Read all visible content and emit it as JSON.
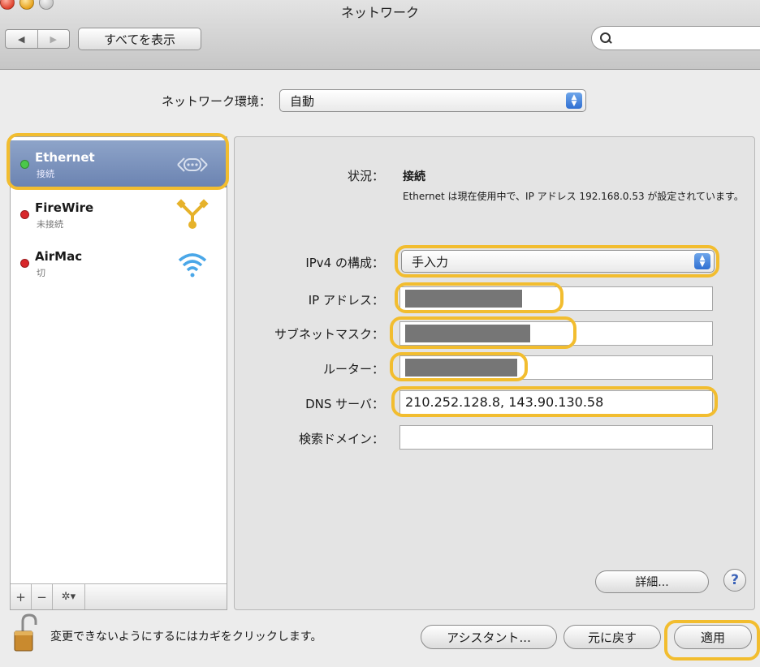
{
  "window": {
    "title": "ネットワーク"
  },
  "toolbar": {
    "back_glyph": "◀",
    "forward_glyph": "▶",
    "show_all_label": "すべてを表示",
    "search_value": "",
    "search_icon": "search-icon"
  },
  "location": {
    "label": "ネットワーク環境：",
    "value": "自動"
  },
  "sidebar": {
    "services": [
      {
        "name": "Ethernet",
        "status": "接続",
        "status_color": "#4bc84b",
        "icon": "ethernet-icon",
        "selected": true
      },
      {
        "name": "FireWire",
        "status": "未接続",
        "status_color": "#d8262a",
        "icon": "firewire-icon",
        "selected": false
      },
      {
        "name": "AirMac",
        "status": "切",
        "status_color": "#d8262a",
        "icon": "wifi-icon",
        "selected": false
      }
    ],
    "add_label": "+",
    "remove_label": "−",
    "gear_label": "✲▾"
  },
  "detail": {
    "status_label": "状況：",
    "status_value": "接続",
    "status_description": "Ethernet は現在使用中で、IP アドレス 192.168.0.53 が設定されています。",
    "ipv4_label": "IPv4 の構成：",
    "ipv4_value": "手入力",
    "ip_label": "IP アドレス：",
    "subnet_label": "サブネットマスク：",
    "router_label": "ルーター：",
    "dns_label": "DNS サーバ：",
    "dns_value": "210.252.128.8, 143.90.130.58",
    "search_domain_label": "検索ドメイン：",
    "search_domain_value": "",
    "advanced_label": "詳細...",
    "help_label": "?"
  },
  "footer": {
    "lock_text": "変更できないようにするにはカギをクリックします。",
    "assistant_label": "アシスタント...",
    "revert_label": "元に戻す",
    "apply_label": "適用"
  },
  "colors": {
    "highlight": "#f2bd2f",
    "selection": "#7a90bd",
    "accent": "#2f6fd2"
  }
}
